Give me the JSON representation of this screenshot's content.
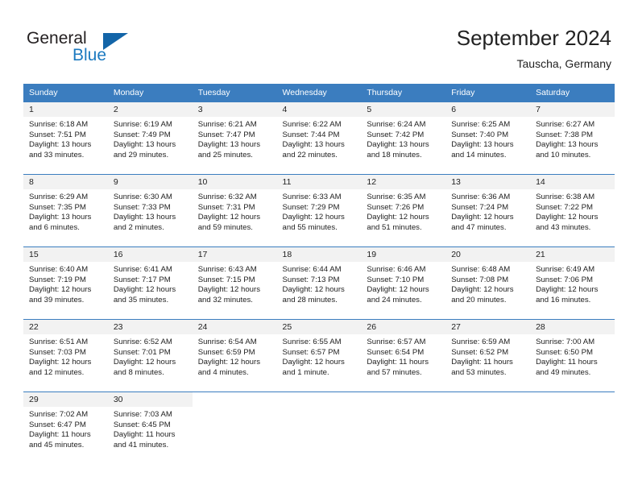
{
  "brand": {
    "name_part1": "General",
    "name_part2": "Blue",
    "logo_icon": "triangle-logo-icon"
  },
  "header": {
    "title": "September 2024",
    "location": "Tauscha, Germany"
  },
  "colors": {
    "header_blue": "#3b7dbf",
    "brand_blue": "#1c7ac0",
    "daynum_band": "#f2f2f2",
    "text": "#222222"
  },
  "calendar": {
    "weekdays": [
      "Sunday",
      "Monday",
      "Tuesday",
      "Wednesday",
      "Thursday",
      "Friday",
      "Saturday"
    ],
    "weeks": [
      [
        {
          "day": "1",
          "sunrise": "Sunrise: 6:18 AM",
          "sunset": "Sunset: 7:51 PM",
          "daylight1": "Daylight: 13 hours",
          "daylight2": "and 33 minutes."
        },
        {
          "day": "2",
          "sunrise": "Sunrise: 6:19 AM",
          "sunset": "Sunset: 7:49 PM",
          "daylight1": "Daylight: 13 hours",
          "daylight2": "and 29 minutes."
        },
        {
          "day": "3",
          "sunrise": "Sunrise: 6:21 AM",
          "sunset": "Sunset: 7:47 PM",
          "daylight1": "Daylight: 13 hours",
          "daylight2": "and 25 minutes."
        },
        {
          "day": "4",
          "sunrise": "Sunrise: 6:22 AM",
          "sunset": "Sunset: 7:44 PM",
          "daylight1": "Daylight: 13 hours",
          "daylight2": "and 22 minutes."
        },
        {
          "day": "5",
          "sunrise": "Sunrise: 6:24 AM",
          "sunset": "Sunset: 7:42 PM",
          "daylight1": "Daylight: 13 hours",
          "daylight2": "and 18 minutes."
        },
        {
          "day": "6",
          "sunrise": "Sunrise: 6:25 AM",
          "sunset": "Sunset: 7:40 PM",
          "daylight1": "Daylight: 13 hours",
          "daylight2": "and 14 minutes."
        },
        {
          "day": "7",
          "sunrise": "Sunrise: 6:27 AM",
          "sunset": "Sunset: 7:38 PM",
          "daylight1": "Daylight: 13 hours",
          "daylight2": "and 10 minutes."
        }
      ],
      [
        {
          "day": "8",
          "sunrise": "Sunrise: 6:29 AM",
          "sunset": "Sunset: 7:35 PM",
          "daylight1": "Daylight: 13 hours",
          "daylight2": "and 6 minutes."
        },
        {
          "day": "9",
          "sunrise": "Sunrise: 6:30 AM",
          "sunset": "Sunset: 7:33 PM",
          "daylight1": "Daylight: 13 hours",
          "daylight2": "and 2 minutes."
        },
        {
          "day": "10",
          "sunrise": "Sunrise: 6:32 AM",
          "sunset": "Sunset: 7:31 PM",
          "daylight1": "Daylight: 12 hours",
          "daylight2": "and 59 minutes."
        },
        {
          "day": "11",
          "sunrise": "Sunrise: 6:33 AM",
          "sunset": "Sunset: 7:29 PM",
          "daylight1": "Daylight: 12 hours",
          "daylight2": "and 55 minutes."
        },
        {
          "day": "12",
          "sunrise": "Sunrise: 6:35 AM",
          "sunset": "Sunset: 7:26 PM",
          "daylight1": "Daylight: 12 hours",
          "daylight2": "and 51 minutes."
        },
        {
          "day": "13",
          "sunrise": "Sunrise: 6:36 AM",
          "sunset": "Sunset: 7:24 PM",
          "daylight1": "Daylight: 12 hours",
          "daylight2": "and 47 minutes."
        },
        {
          "day": "14",
          "sunrise": "Sunrise: 6:38 AM",
          "sunset": "Sunset: 7:22 PM",
          "daylight1": "Daylight: 12 hours",
          "daylight2": "and 43 minutes."
        }
      ],
      [
        {
          "day": "15",
          "sunrise": "Sunrise: 6:40 AM",
          "sunset": "Sunset: 7:19 PM",
          "daylight1": "Daylight: 12 hours",
          "daylight2": "and 39 minutes."
        },
        {
          "day": "16",
          "sunrise": "Sunrise: 6:41 AM",
          "sunset": "Sunset: 7:17 PM",
          "daylight1": "Daylight: 12 hours",
          "daylight2": "and 35 minutes."
        },
        {
          "day": "17",
          "sunrise": "Sunrise: 6:43 AM",
          "sunset": "Sunset: 7:15 PM",
          "daylight1": "Daylight: 12 hours",
          "daylight2": "and 32 minutes."
        },
        {
          "day": "18",
          "sunrise": "Sunrise: 6:44 AM",
          "sunset": "Sunset: 7:13 PM",
          "daylight1": "Daylight: 12 hours",
          "daylight2": "and 28 minutes."
        },
        {
          "day": "19",
          "sunrise": "Sunrise: 6:46 AM",
          "sunset": "Sunset: 7:10 PM",
          "daylight1": "Daylight: 12 hours",
          "daylight2": "and 24 minutes."
        },
        {
          "day": "20",
          "sunrise": "Sunrise: 6:48 AM",
          "sunset": "Sunset: 7:08 PM",
          "daylight1": "Daylight: 12 hours",
          "daylight2": "and 20 minutes."
        },
        {
          "day": "21",
          "sunrise": "Sunrise: 6:49 AM",
          "sunset": "Sunset: 7:06 PM",
          "daylight1": "Daylight: 12 hours",
          "daylight2": "and 16 minutes."
        }
      ],
      [
        {
          "day": "22",
          "sunrise": "Sunrise: 6:51 AM",
          "sunset": "Sunset: 7:03 PM",
          "daylight1": "Daylight: 12 hours",
          "daylight2": "and 12 minutes."
        },
        {
          "day": "23",
          "sunrise": "Sunrise: 6:52 AM",
          "sunset": "Sunset: 7:01 PM",
          "daylight1": "Daylight: 12 hours",
          "daylight2": "and 8 minutes."
        },
        {
          "day": "24",
          "sunrise": "Sunrise: 6:54 AM",
          "sunset": "Sunset: 6:59 PM",
          "daylight1": "Daylight: 12 hours",
          "daylight2": "and 4 minutes."
        },
        {
          "day": "25",
          "sunrise": "Sunrise: 6:55 AM",
          "sunset": "Sunset: 6:57 PM",
          "daylight1": "Daylight: 12 hours",
          "daylight2": "and 1 minute."
        },
        {
          "day": "26",
          "sunrise": "Sunrise: 6:57 AM",
          "sunset": "Sunset: 6:54 PM",
          "daylight1": "Daylight: 11 hours",
          "daylight2": "and 57 minutes."
        },
        {
          "day": "27",
          "sunrise": "Sunrise: 6:59 AM",
          "sunset": "Sunset: 6:52 PM",
          "daylight1": "Daylight: 11 hours",
          "daylight2": "and 53 minutes."
        },
        {
          "day": "28",
          "sunrise": "Sunrise: 7:00 AM",
          "sunset": "Sunset: 6:50 PM",
          "daylight1": "Daylight: 11 hours",
          "daylight2": "and 49 minutes."
        }
      ],
      [
        {
          "day": "29",
          "sunrise": "Sunrise: 7:02 AM",
          "sunset": "Sunset: 6:47 PM",
          "daylight1": "Daylight: 11 hours",
          "daylight2": "and 45 minutes."
        },
        {
          "day": "30",
          "sunrise": "Sunrise: 7:03 AM",
          "sunset": "Sunset: 6:45 PM",
          "daylight1": "Daylight: 11 hours",
          "daylight2": "and 41 minutes."
        },
        {
          "day": "",
          "sunrise": "",
          "sunset": "",
          "daylight1": "",
          "daylight2": ""
        },
        {
          "day": "",
          "sunrise": "",
          "sunset": "",
          "daylight1": "",
          "daylight2": ""
        },
        {
          "day": "",
          "sunrise": "",
          "sunset": "",
          "daylight1": "",
          "daylight2": ""
        },
        {
          "day": "",
          "sunrise": "",
          "sunset": "",
          "daylight1": "",
          "daylight2": ""
        },
        {
          "day": "",
          "sunrise": "",
          "sunset": "",
          "daylight1": "",
          "daylight2": ""
        }
      ]
    ]
  }
}
